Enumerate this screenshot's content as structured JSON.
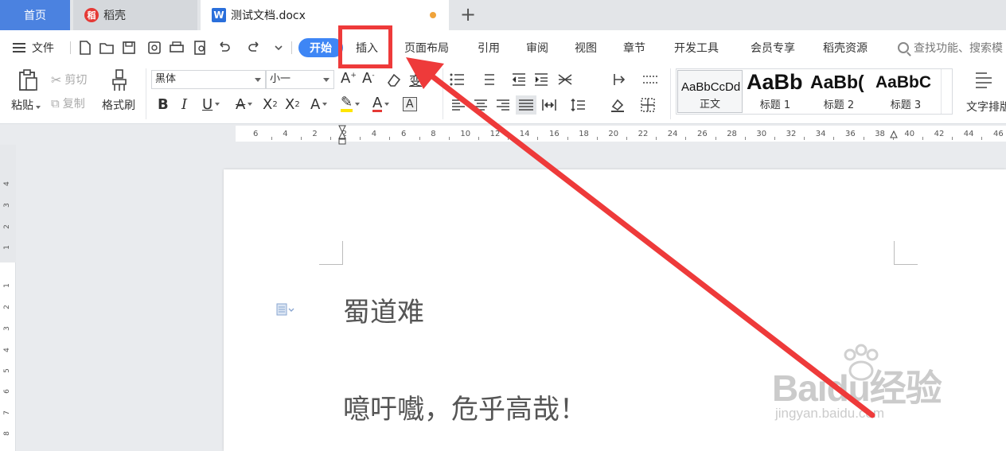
{
  "tabs": {
    "home": "首页",
    "daoke": "稻壳",
    "daoke_logo": "稻",
    "document": "测试文档.docx",
    "doc_logo": "W"
  },
  "menubar": {
    "file": "文件",
    "start": "开始",
    "items": [
      "插入",
      "页面布局",
      "引用",
      "审阅",
      "视图",
      "章节",
      "开发工具",
      "会员专享",
      "稻壳资源"
    ],
    "search": "查找功能、搜索模"
  },
  "ribbon": {
    "paste": "粘贴",
    "cut": "剪切",
    "copy": "复制",
    "format_painter": "格式刷",
    "font_name": "黑体",
    "font_size": "小一",
    "text_layout": "文字排版",
    "styles": [
      {
        "sample": "AaBbCcDd",
        "name": "正文"
      },
      {
        "sample": "AaBb",
        "name": "标题 1"
      },
      {
        "sample": "AaBb(",
        "name": "标题 2"
      },
      {
        "sample": "AaBbC",
        "name": "标题 3"
      }
    ]
  },
  "ruler": {
    "h_ticks": [
      "6",
      "4",
      "2",
      "2",
      "4",
      "6",
      "8",
      "10",
      "12",
      "14",
      "16",
      "18",
      "20",
      "22",
      "24",
      "26",
      "28",
      "30",
      "32",
      "34",
      "36",
      "38",
      "40",
      "42",
      "44",
      "46"
    ],
    "v_ticks": [
      "4",
      "3",
      "2",
      "1",
      "1",
      "2",
      "3",
      "4",
      "5",
      "6",
      "7",
      "8"
    ]
  },
  "document": {
    "title": "蜀道难",
    "line1": "噫吁嚱，危乎高哉！"
  },
  "watermark": {
    "brand": "Baidu经验",
    "url": "jingyan.baidu.com"
  },
  "colors": {
    "accent": "#3e86f5",
    "home_tab": "#4b82e0",
    "annotation": "#ee3a3a"
  }
}
